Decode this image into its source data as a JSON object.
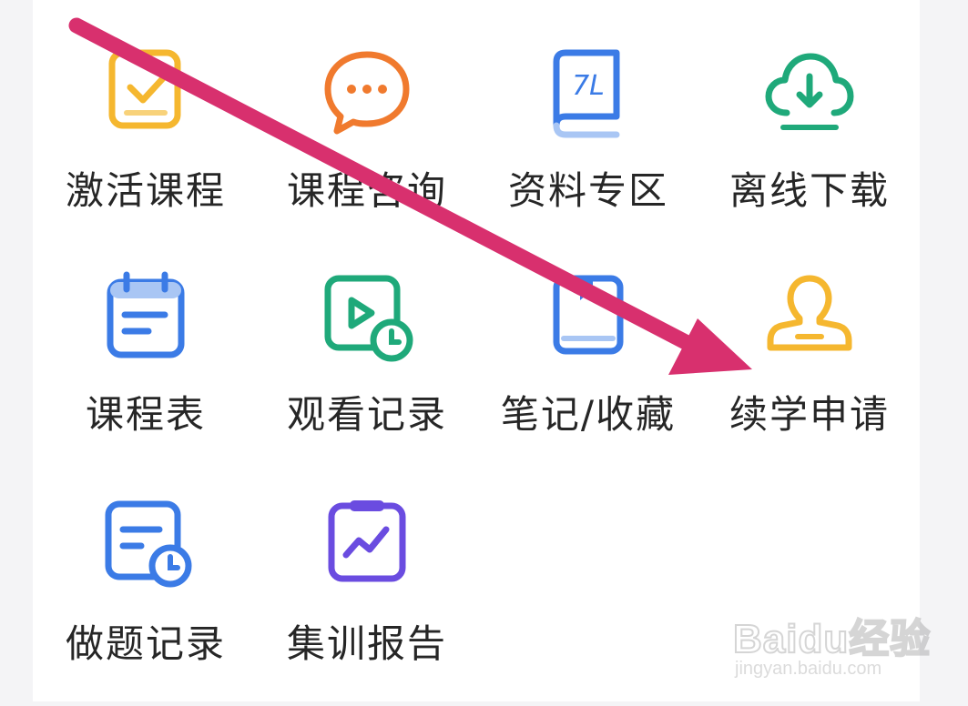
{
  "menu": {
    "items": [
      {
        "label": "激活课程",
        "icon": "activate-course-icon",
        "color": "#F5B72F"
      },
      {
        "label": "课程咨询",
        "icon": "chat-bubble-icon",
        "color": "#F07A2E"
      },
      {
        "label": "资料专区",
        "icon": "book-icon",
        "color": "#3B7BE6"
      },
      {
        "label": "离线下载",
        "icon": "cloud-download-icon",
        "color": "#1FA97A"
      },
      {
        "label": "课程表",
        "icon": "calendar-icon",
        "color": "#3B7BE6"
      },
      {
        "label": "观看记录",
        "icon": "watch-history-icon",
        "color": "#1FA97A"
      },
      {
        "label": "笔记/收藏",
        "icon": "notebook-icon",
        "color": "#3B7BE6"
      },
      {
        "label": "续学申请",
        "icon": "person-stamp-icon",
        "color": "#F5B72F"
      },
      {
        "label": "做题记录",
        "icon": "exercise-record-icon",
        "color": "#3B7BE6"
      },
      {
        "label": "集训报告",
        "icon": "trend-report-icon",
        "color": "#6A4CE0"
      }
    ]
  },
  "annotation": {
    "arrow_color": "#D8306E"
  },
  "watermark": {
    "brand": "Baidu经验",
    "url": "jingyan.baidu.com"
  }
}
